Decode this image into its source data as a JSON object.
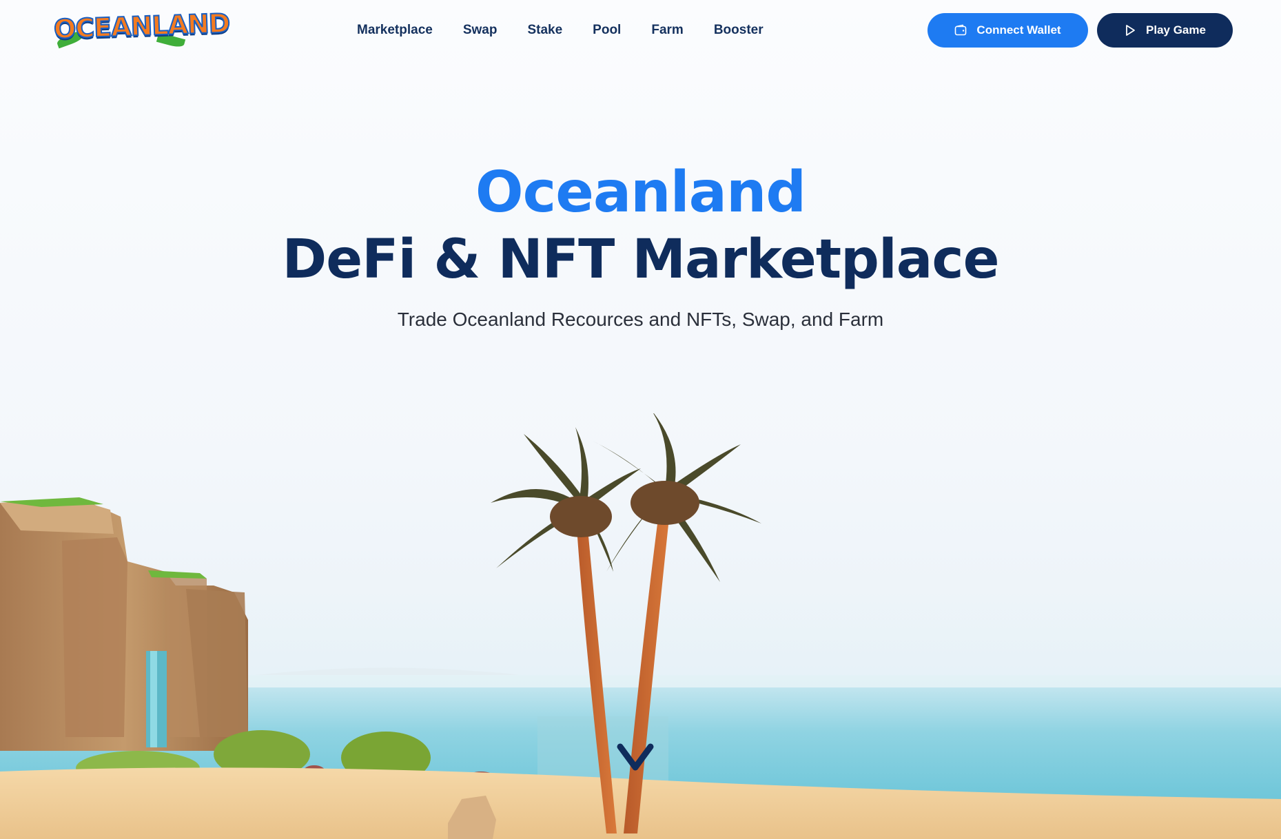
{
  "header": {
    "logo_text": "OCEANLAND",
    "nav": [
      {
        "label": "Marketplace"
      },
      {
        "label": "Swap"
      },
      {
        "label": "Stake"
      },
      {
        "label": "Pool"
      },
      {
        "label": "Farm"
      },
      {
        "label": "Booster"
      }
    ],
    "connect_wallet_label": "Connect Wallet",
    "connect_wallet_icon": "wallet-icon",
    "play_game_label": "Play Game",
    "play_game_icon": "play-icon"
  },
  "hero": {
    "title_line1": "Oceanland",
    "title_line2": "DeFi & NFT Marketplace",
    "subtitle": "Trade Oceanland Recources and NFTs, Swap, and Farm"
  },
  "scene": {
    "scroll_icon": "chevron-down-icon"
  },
  "colors": {
    "accent_blue": "#1e7bf2",
    "navy": "#0f2c5c",
    "sea": "#7fcfdf"
  }
}
